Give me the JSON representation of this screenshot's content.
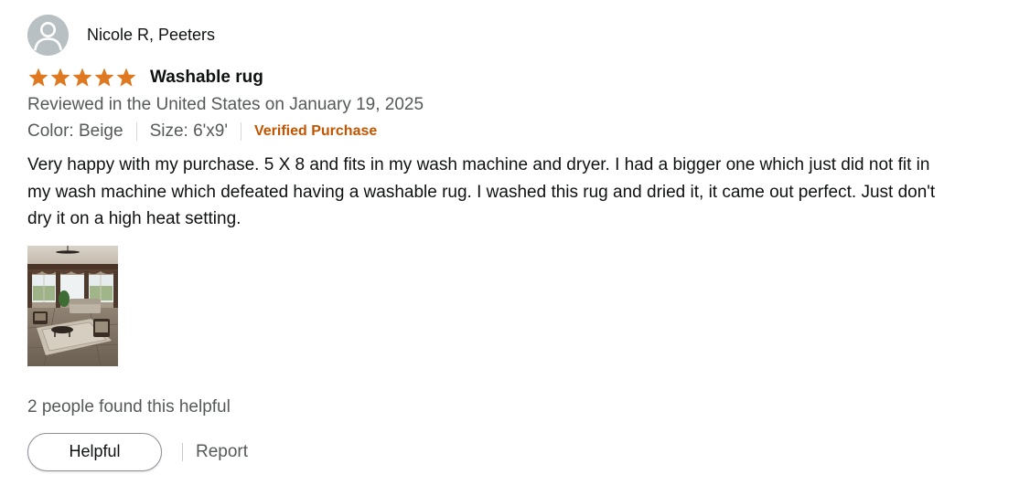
{
  "review": {
    "reviewer_name": "Nicole R, Peeters",
    "rating_stars": 5,
    "star_color": "#de7921",
    "title": "Washable rug",
    "date_line": "Reviewed in the United States on January 19, 2025",
    "color_option": "Color: Beige",
    "size_option": "Size: 6'x9'",
    "verified_label": "Verified Purchase",
    "verified_color": "#c45500",
    "body": "Very happy with my purchase. 5 X 8 and fits in my wash machine and dryer. I had a bigger one which just did not fit in my wash machine which defeated having a washable rug. I washed this rug and dried it, it came out perfect. Just don't dry it on a high heat setting.",
    "helpful_count_text": "2 people found this helpful",
    "helpful_button_label": "Helpful",
    "report_label": "Report"
  }
}
